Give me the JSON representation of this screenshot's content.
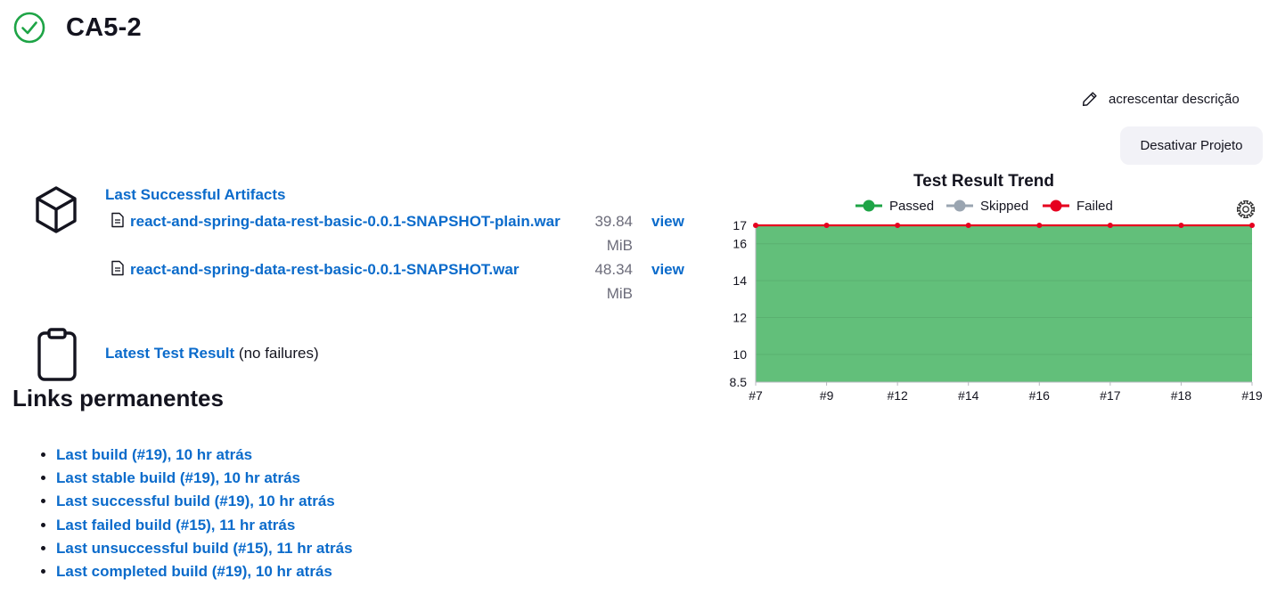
{
  "header": {
    "title": "CA5-2",
    "status_icon": "check-circle-icon",
    "status_color": "#1ea446"
  },
  "actions": {
    "add_description": "acrescentar descrição",
    "disable_project": "Desativar Projeto"
  },
  "artifacts": {
    "title": "Last Successful Artifacts",
    "items": [
      {
        "name": "react-and-spring-data-rest-basic-0.0.1-SNAPSHOT-plain.war",
        "size": "39.84 MiB",
        "view": "view"
      },
      {
        "name": "react-and-spring-data-rest-basic-0.0.1-SNAPSHOT.war",
        "size": "48.34 MiB",
        "view": "view"
      }
    ]
  },
  "test_result": {
    "link": "Latest Test Result",
    "suffix": "(no failures)"
  },
  "permalinks": {
    "heading": "Links permanentes",
    "items": [
      "Last build (#19), 10 hr atrás",
      "Last stable build (#19), 10 hr atrás",
      "Last successful build (#19), 10 hr atrás",
      "Last failed build (#15), 11 hr atrás",
      "Last unsuccessful build (#15), 11 hr atrás",
      "Last completed build (#19), 10 hr atrás"
    ]
  },
  "chart_data": {
    "type": "area",
    "title": "Test Result Trend",
    "categories": [
      "#7",
      "#9",
      "#12",
      "#14",
      "#16",
      "#17",
      "#18",
      "#19"
    ],
    "ylim": [
      8.5,
      17
    ],
    "yticks": [
      "8.5",
      "10",
      "12",
      "14",
      "16",
      "17"
    ],
    "legend_position": "top",
    "series": [
      {
        "name": "Passed",
        "color": "#1ea446",
        "values": [
          17,
          17,
          17,
          17,
          17,
          17,
          17,
          17
        ]
      },
      {
        "name": "Skipped",
        "color": "#9aa5b1",
        "values": [
          0,
          0,
          0,
          0,
          0,
          0,
          0,
          0
        ]
      },
      {
        "name": "Failed",
        "color": "#e6001f",
        "values": [
          0,
          0,
          0,
          0,
          0,
          0,
          0,
          0
        ]
      }
    ],
    "grid": true
  }
}
